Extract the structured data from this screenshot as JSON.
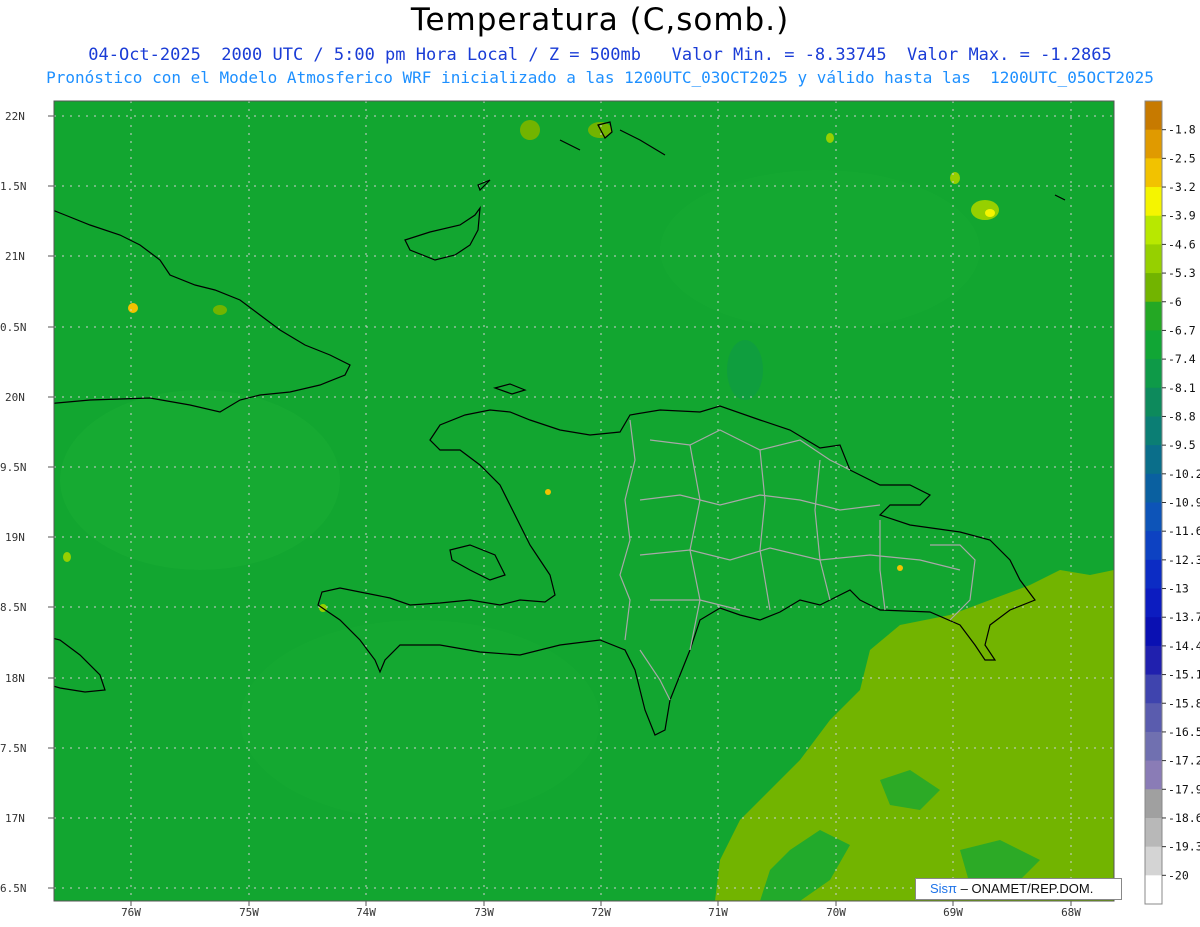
{
  "header": {
    "title": "Temperatura (C,somb.)",
    "line1": "04-Oct-2025  2000 UTC / 5:00 pm Hora Local / Z = 500mb   Valor Min. = -8.33745  Valor Max. = -1.2865",
    "line2": "Pronóstico con el Modelo Atmosferico WRF inicializado a las 1200UTC_03OCT2025 y válido hasta las  1200UTC_05OCT2025"
  },
  "axes": {
    "lat_labels": [
      "22N",
      "1.5N",
      "21N",
      "0.5N",
      "20N",
      "9.5N",
      "19N",
      "8.5N",
      "18N",
      "7.5N",
      "17N",
      "6.5N"
    ],
    "lon_labels": [
      "76W",
      "75W",
      "74W",
      "73W",
      "72W",
      "71W",
      "70W",
      "69W",
      "68W"
    ]
  },
  "colorbar": {
    "labels": [
      "-1.8",
      "-2.5",
      "-3.2",
      "-3.9",
      "-4.6",
      "-5.3",
      "-6",
      "-6.7",
      "-7.4",
      "-8.1",
      "-8.8",
      "-9.5",
      "-10.2",
      "-10.9",
      "-11.6",
      "-12.3",
      "-13",
      "-13.7",
      "-14.4",
      "-15.1",
      "-15.8",
      "-16.5",
      "-17.2",
      "-17.9",
      "-18.6",
      "-19.3",
      "-20"
    ],
    "colors": [
      "#c77a00",
      "#e09a00",
      "#f2c200",
      "#f5f500",
      "#b8e800",
      "#96d000",
      "#72b400",
      "#24a824",
      "#11a635",
      "#0e9a48",
      "#0d8a5c",
      "#0b7e74",
      "#0a6e8a",
      "#0a60a0",
      "#0d54b8",
      "#0d42c2",
      "#0c2cc4",
      "#0c1cc0",
      "#0a10b2",
      "#2020ae",
      "#3f44ae",
      "#5a5cae",
      "#7070b0",
      "#8a7cb6",
      "#a0a0a0",
      "#b8b8b8",
      "#d4d4d4",
      "#ffffff"
    ]
  },
  "credit": {
    "brand": "Sisπ",
    "text": " – ONAMET/REP.DOM."
  }
}
